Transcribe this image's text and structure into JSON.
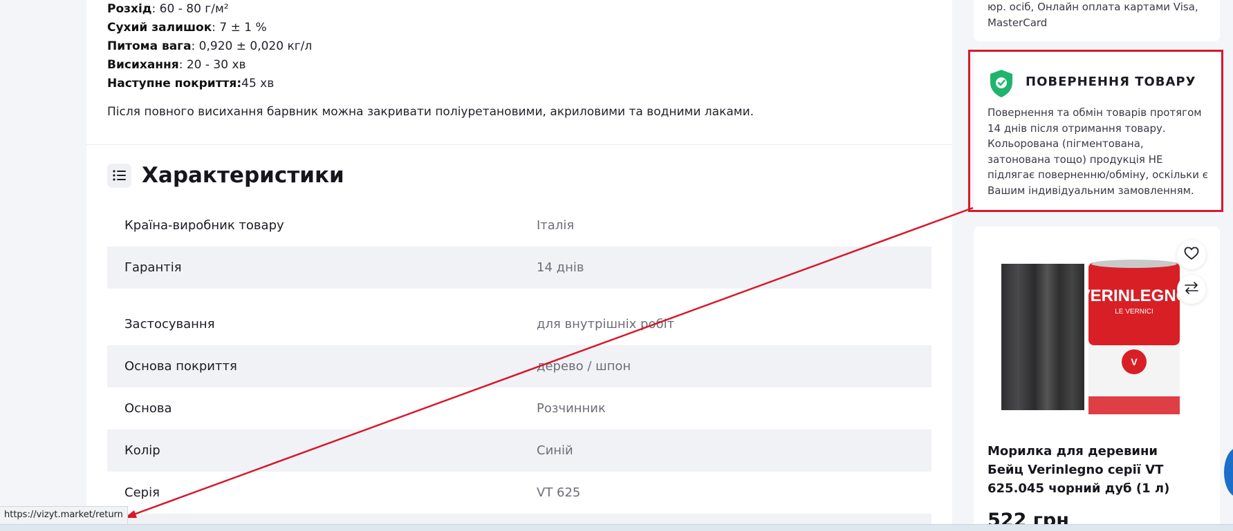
{
  "specs": [
    {
      "label": "Розхід",
      "value": ": 60 - 80 г/м²"
    },
    {
      "label": "Сухий залишок",
      "value": ": 7 ± 1 %"
    },
    {
      "label": "Питома вага",
      "value": ": 0,920 ± 0,020 кг/л"
    },
    {
      "label": "Висихання",
      "value": ": 20 - 30 хв"
    },
    {
      "label": "Наступне покриття:",
      "value": "45 хв"
    }
  ],
  "after_text": "Після повного висихання барвник можна закривати поліуретановими, акриловими та водними лаками.",
  "characteristics": {
    "title": "Характеристики",
    "icon": "list-icon",
    "rows": [
      {
        "key": "Країна-виробник товару",
        "value": "Італія"
      },
      {
        "key": "Гарантія",
        "value": "14 днів"
      },
      {
        "key": "Застосування",
        "value": "для внутрішніх робіт"
      },
      {
        "key": "Основа покриття",
        "value": "дерево / шпон"
      },
      {
        "key": "Основа",
        "value": "Розчинник"
      },
      {
        "key": "Колір",
        "value": "Синій"
      },
      {
        "key": "Серія",
        "value": "VT 625"
      }
    ]
  },
  "sidebar": {
    "payment_text": "юр. осіб, Онлайн оплата картами Visa, MasterCard",
    "return": {
      "icon": "shield-check-icon",
      "title": "ПОВЕРНЕННЯ ТОВАРУ",
      "text": "Повернення та обмін товарів протягом 14 днів після отримання товару. Кольорована (пігментована, затонована тощо) продукція НЕ підлягає поверненню/обміну, оскільки є Вашим індивідуальним замовленням."
    },
    "product": {
      "name": "Морилка для деревини Бейц Verinlegno серії VT 625.045 чорний дуб (1 л)",
      "price": "522 грн",
      "can_brand": "VERINLEGNO",
      "can_sub": "LE VERNICI",
      "favorite_icon": "heart-icon",
      "compare_icon": "compare-arrows-icon"
    }
  },
  "status_url": "https://vizyt.market/return",
  "colors": {
    "annotation_red": "#d7182a",
    "shield_green": "#1fb46e",
    "row_shade": "#f1f2f6"
  }
}
